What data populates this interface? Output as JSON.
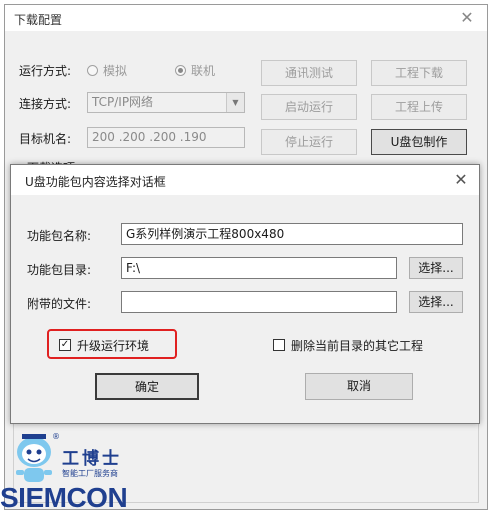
{
  "outer": {
    "title": "下载配置",
    "close": "✕",
    "run_mode_label": "运行方式:",
    "radio_sim": "模拟",
    "radio_online": "联机",
    "connect_label": "连接方式:",
    "connect_value": "TCP/IP网络",
    "target_label": "目标机名:",
    "target_value": "200 .200 .200 .190",
    "buttons": {
      "comm_test": "通讯测试",
      "start_run": "启动运行",
      "stop_run": "停止运行",
      "project_download": "工程下载",
      "project_upload": "工程上传",
      "usb_make": "U盘包制作"
    },
    "download_options_partial": "下载选项"
  },
  "dialog": {
    "title": "U盘功能包内容选择对话框",
    "close": "✕",
    "pkg_name_label": "功能包名称:",
    "pkg_name_value": "G系列样例演示工程800x480",
    "pkg_dir_label": "功能包目录:",
    "pkg_dir_value": "F:\\",
    "attach_label": "附带的文件:",
    "attach_value": "",
    "choose1": "选择...",
    "choose2": "选择...",
    "upgrade_env_label": "升级运行环境",
    "upgrade_env_checked": "✓",
    "delete_other_label": "删除当前目录的其它工程",
    "ok": "确定",
    "cancel": "取消"
  },
  "logo": {
    "brand_cn": "工博士",
    "tagline": "智能工厂服务商",
    "wordmark": "SIEMCON",
    "registered": "®"
  },
  "colors": {
    "highlight": "#e02020",
    "brand_blue": "#1f3f8f"
  }
}
